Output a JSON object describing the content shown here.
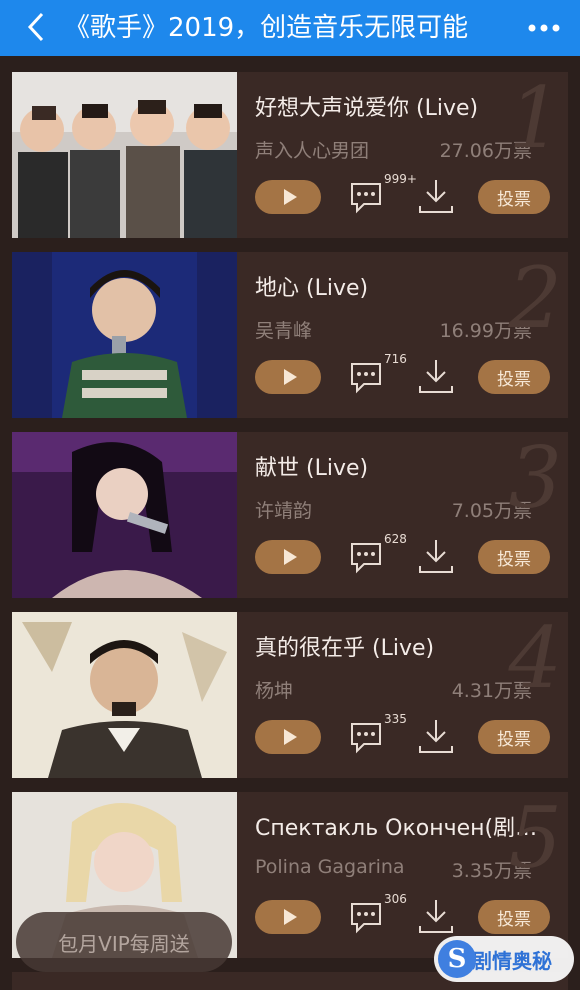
{
  "header": {
    "title": "《歌手》2019，创造音乐无限可能",
    "back_icon": "chevron-left-icon",
    "more_icon": "more-dots-icon",
    "bg_color": "#1e88ec"
  },
  "songs": [
    {
      "rank": "1",
      "title": "好想大声说爱你 (Live)",
      "artist": "声入人心男团",
      "votes": "27.06万票",
      "comments": "999+",
      "vote_label": "投票"
    },
    {
      "rank": "2",
      "title": "地心 (Live)",
      "artist": "吴青峰",
      "votes": "16.99万票",
      "comments": "716",
      "vote_label": "投票"
    },
    {
      "rank": "3",
      "title": "献世 (Live)",
      "artist": "许靖韵",
      "votes": "7.05万票",
      "comments": "628",
      "vote_label": "投票"
    },
    {
      "rank": "4",
      "title": "真的很在乎 (Live)",
      "artist": "杨坤",
      "votes": "4.31万票",
      "comments": "335",
      "vote_label": "投票"
    },
    {
      "rank": "5",
      "title": "Спектакль Окончен(剧情奥秘)",
      "artist": "Polina Gagarina",
      "votes": "3.35万票",
      "comments": "306",
      "vote_label": "投票"
    }
  ],
  "vip_banner": "包月VIP每周送",
  "watermark": {
    "logo_letter": "S",
    "text": "剧情奥秘"
  },
  "colors": {
    "accent": "#a47445",
    "card": "#3a2925",
    "page": "#2b1f1c"
  }
}
